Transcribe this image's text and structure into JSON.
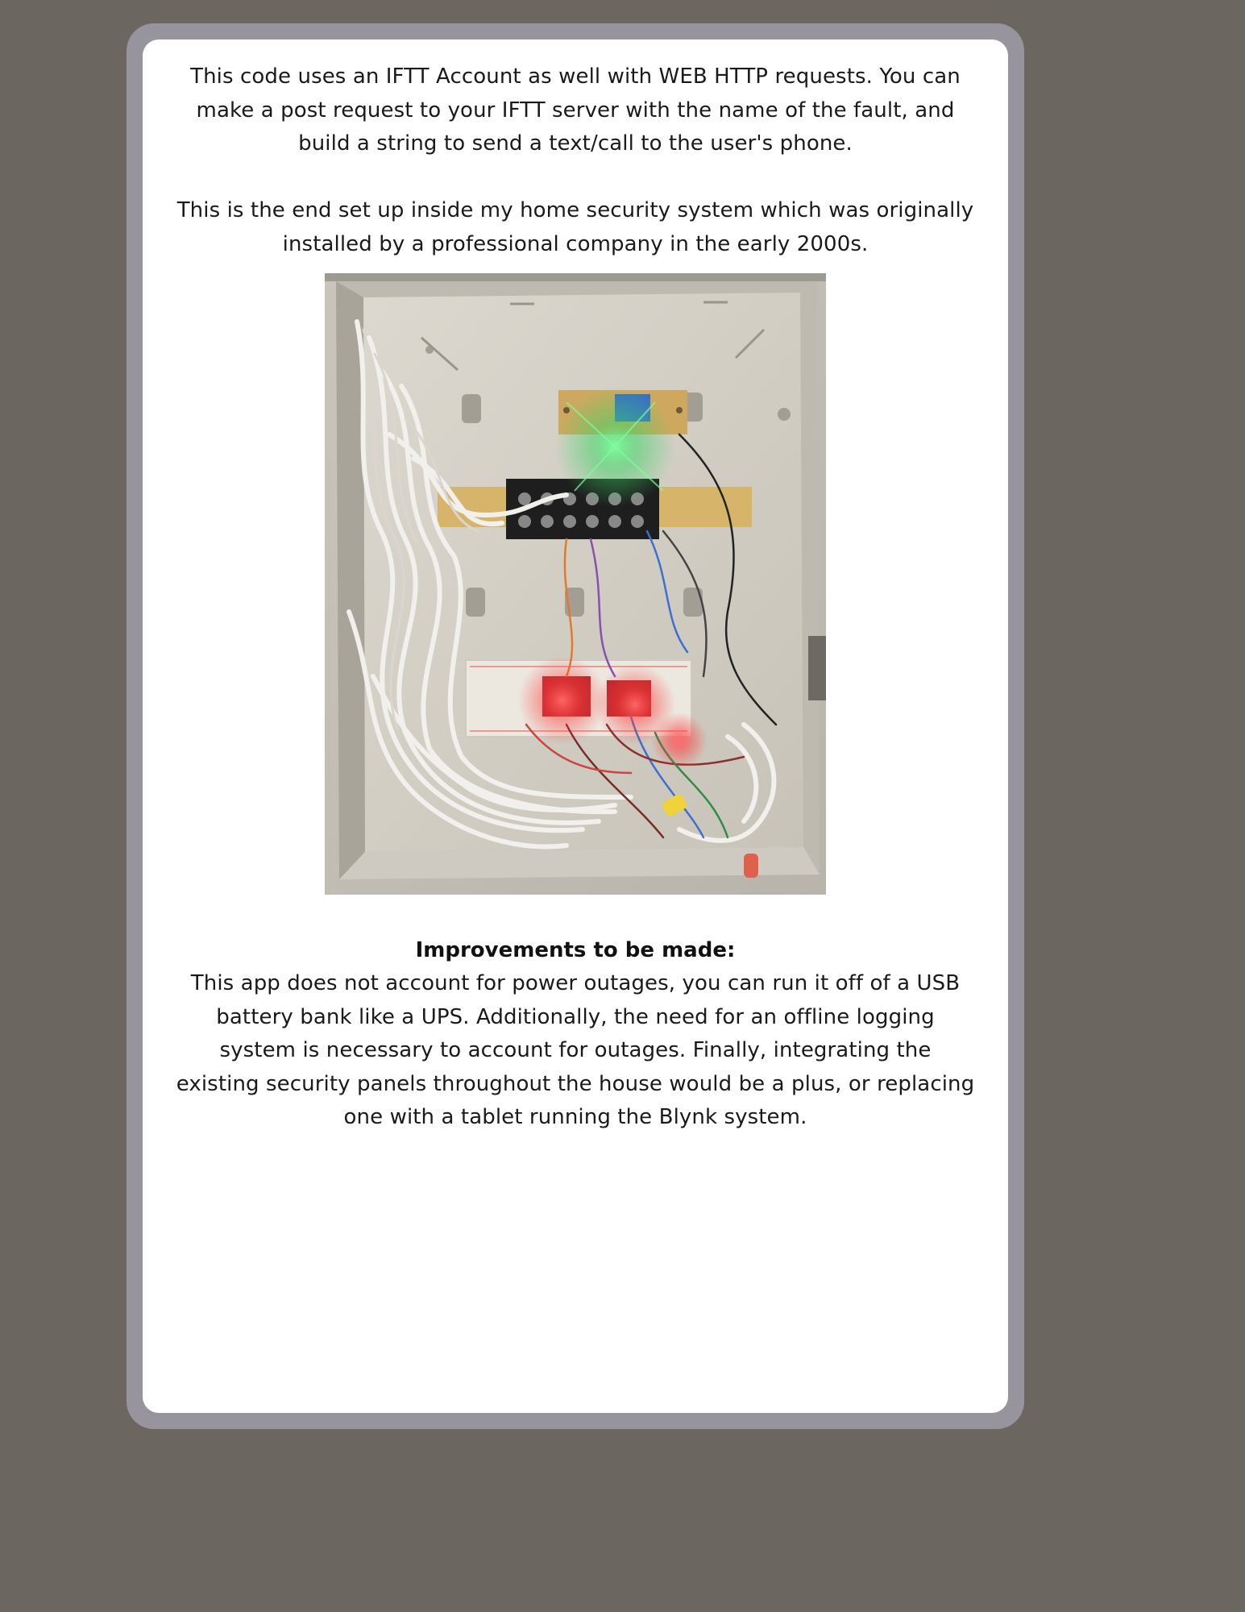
{
  "intro": {
    "paragraph": "This code uses an IFTT Account as well with WEB HTTP requests. You can make a post request to your IFTT server with the name of the fault, and build a string to send a text/call to the user's phone."
  },
  "setup": {
    "paragraph": "This is the end set up inside my home security system which was originally installed by a professional company in the early 2000s."
  },
  "photo": {
    "description_icon": "security-panel-photo"
  },
  "improvements": {
    "heading": "Improvements to be made:",
    "paragraph": "This app does not account for power outages, you can run it off of a USB battery bank like a UPS. Additionally, the need for an offline logging system is necessary to account for outages. Finally, integrating the existing security panels throughout the house would be a plus, or replacing one with a tablet running the Blynk system."
  },
  "colors": {
    "page_background": "#6b6660",
    "frame": "#98949d",
    "card": "#ffffff",
    "text": "#1a1a1a"
  }
}
